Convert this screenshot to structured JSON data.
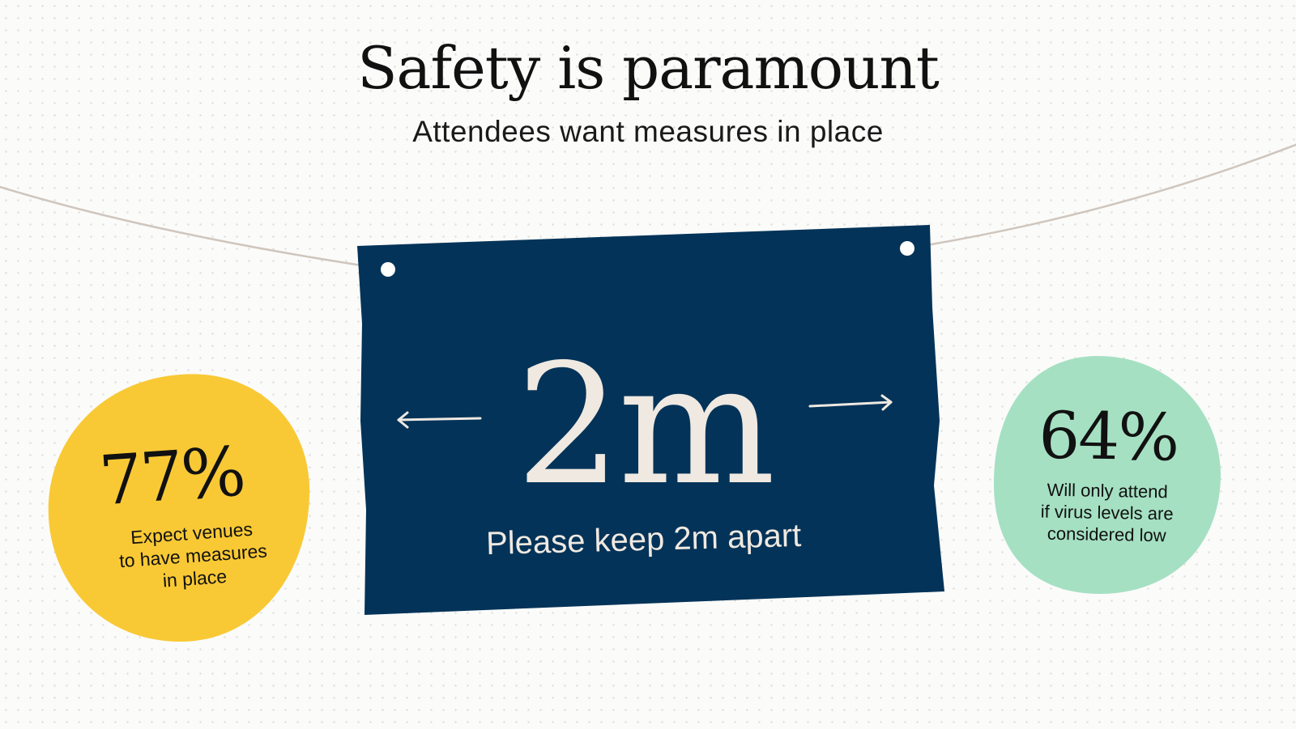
{
  "header": {
    "title": "Safety is paramount",
    "subtitle": "Attendees want measures in place"
  },
  "sign": {
    "headline": "2m",
    "caption": "Please keep 2m apart",
    "arrows": [
      "arrow-left-icon",
      "arrow-right-icon"
    ]
  },
  "stats": [
    {
      "value": "77%",
      "caption": "Expect venues\nto have measures\nin place",
      "color": "#f9c935"
    },
    {
      "value": "64%",
      "caption": "Will only attend\nif virus levels are\nconsidered low",
      "color": "#a5e0c2"
    }
  ],
  "colors": {
    "sign": "#033358",
    "sign_text": "#efe9e1",
    "string": "#cfc6bd"
  }
}
